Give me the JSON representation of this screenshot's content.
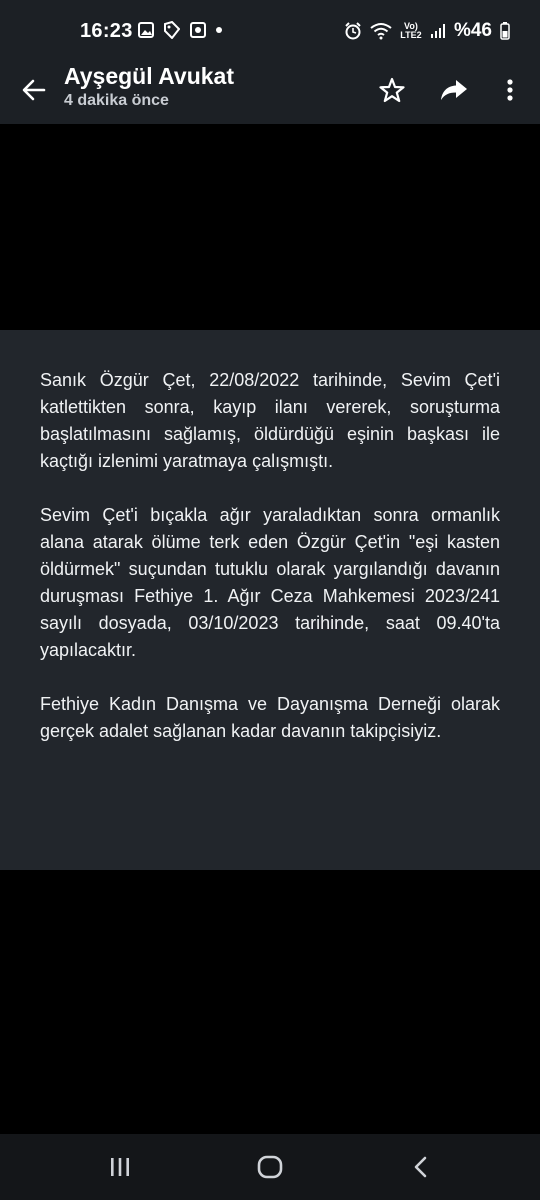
{
  "status_bar": {
    "time": "16:23",
    "battery": "%46",
    "network_label": "Vo) LTE2"
  },
  "app_bar": {
    "title": "Ayşegül Avukat",
    "subtitle": "4 dakika önce"
  },
  "post": {
    "paragraphs": [
      "Sanık Özgür Çet, 22/08/2022 tarihinde, Sevim Çet'i katlettikten sonra, kayıp ilanı vererek, soruşturma başlatılmasını sağlamış, öldürdüğü eşinin başkası ile kaçtığı izlenimi yaratmaya çalışmıştı.",
      "Sevim Çet'i bıçakla ağır yaraladıktan sonra ormanlık alana atarak ölüme terk eden Özgür Çet'in \"eşi kasten öldürmek\" suçundan tutuklu olarak yargılandığı davanın duruşması Fethiye 1. Ağır Ceza Mahkemesi 2023/241 sayılı dosyada, 03/10/2023 tarihinde, saat 09.40'ta yapılacaktır.",
      "Fethiye Kadın Danışma ve Dayanışma Derneği olarak gerçek adalet sağlanan kadar davanın takipçisiyiz."
    ]
  },
  "colors": {
    "header_bg": "#1c2025",
    "card_bg": "#22262c",
    "nav_bg": "#141619",
    "text": "#f0f2f4"
  },
  "icons": {
    "back": "arrow-left-icon",
    "star": "star-outline-icon",
    "share": "share-arrow-icon",
    "more": "more-vertical-icon"
  }
}
